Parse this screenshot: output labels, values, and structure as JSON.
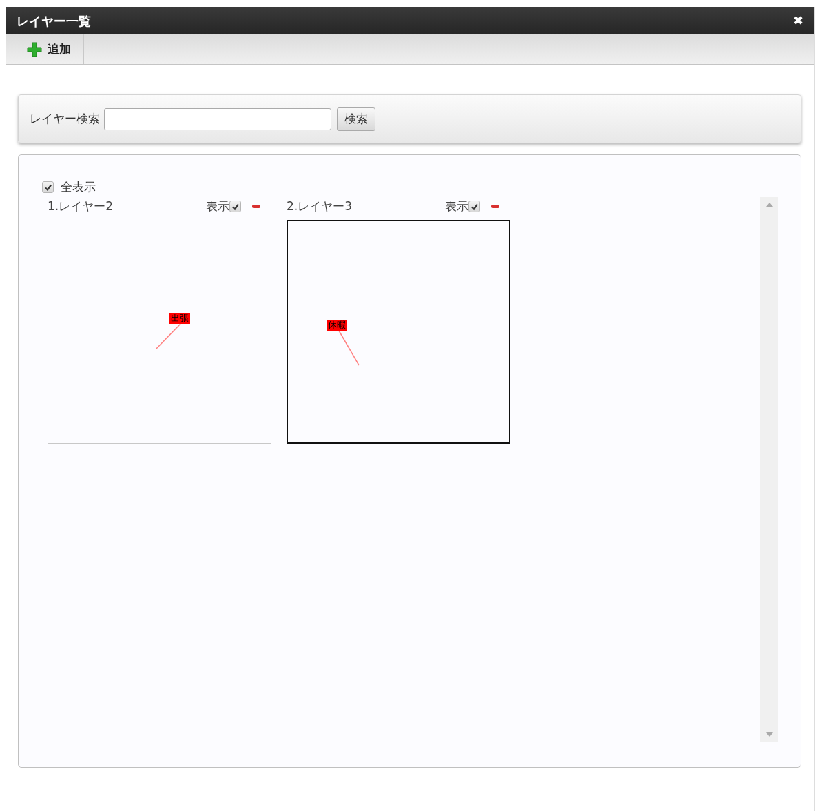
{
  "window": {
    "title": "レイヤー一覧",
    "close": "✖"
  },
  "toolbar": {
    "add_button": "追加"
  },
  "search": {
    "label": "レイヤー検索",
    "button": "検索"
  },
  "show_all": {
    "label": "全表示",
    "checked": true
  },
  "layers": [
    {
      "title": "1.レイヤー2",
      "visible_label": "表示",
      "visible": true,
      "selected": false,
      "tag": "出張"
    },
    {
      "title": "2.レイヤー3",
      "visible_label": "表示",
      "visible": true,
      "selected": true,
      "tag": "休暇"
    }
  ]
}
